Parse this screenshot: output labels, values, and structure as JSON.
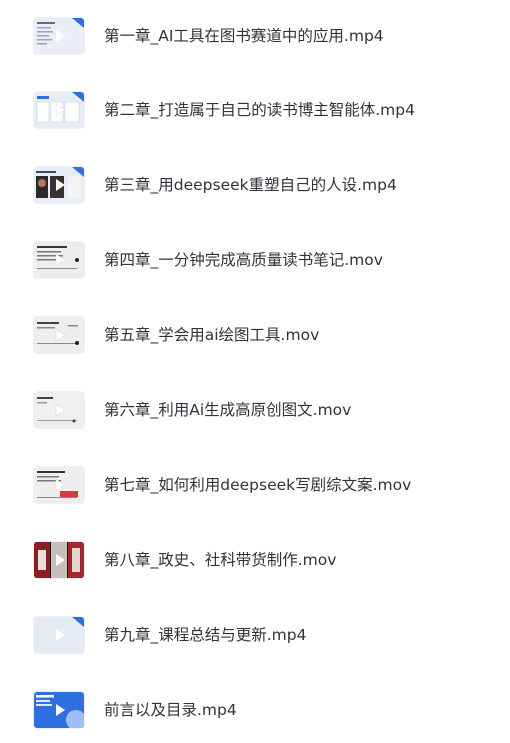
{
  "files": [
    {
      "name": "第一章_AI工具在图书赛道中的应用.mp4",
      "thumbnail": "light-slide"
    },
    {
      "name": "第二章_打造属于自己的读书博主智能体.mp4",
      "thumbnail": "light-slide"
    },
    {
      "name": "第三章_用deepseek重塑自己的人设.mp4",
      "thumbnail": "photo-slide"
    },
    {
      "name": "第四章_一分钟完成高质量读书笔记.mov",
      "thumbnail": "gray-slide"
    },
    {
      "name": "第五章_学会用ai绘图工具.mov",
      "thumbnail": "gray-slide"
    },
    {
      "name": "第六章_利用Ai生成高原创图文.mov",
      "thumbnail": "gray-slide"
    },
    {
      "name": "第七章_如何利用deepseek写剧综文案.mov",
      "thumbnail": "gray-slide-red"
    },
    {
      "name": "第八章_政史、社科带货制作.mov",
      "thumbnail": "red-photo"
    },
    {
      "name": "第九章_课程总结与更新.mp4",
      "thumbnail": "blank-slide"
    },
    {
      "name": "前言以及目录.mp4",
      "thumbnail": "blue-slide"
    }
  ],
  "colors": {
    "accent": "#2f6fe0",
    "play_icon": "#ffffff",
    "text": "#2f333b"
  }
}
